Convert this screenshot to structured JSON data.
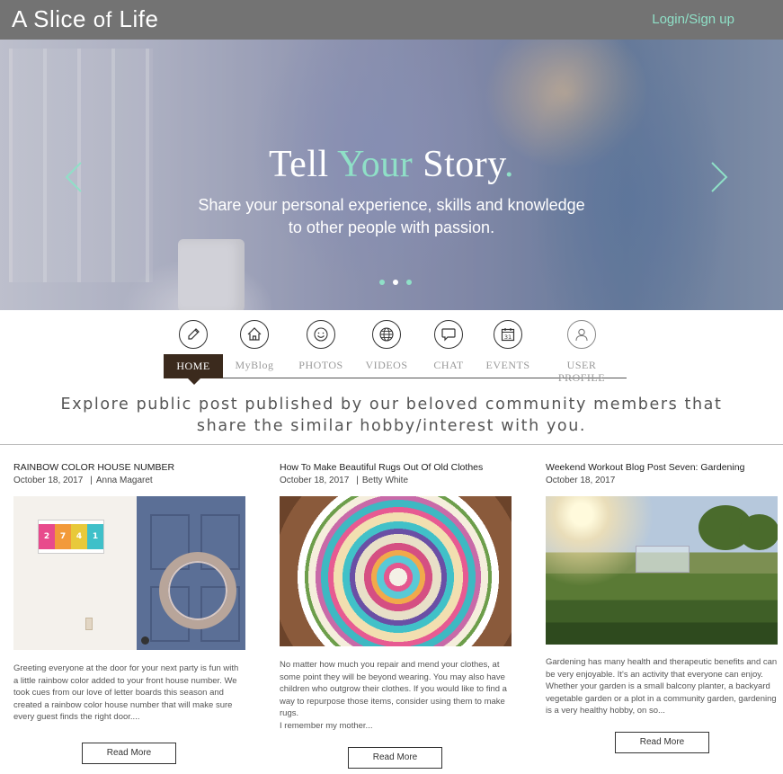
{
  "header": {
    "logo_part1": "A Slice",
    "logo_part2": "of",
    "logo_part3": "Life",
    "login_label": "Login/Sign up"
  },
  "hero": {
    "title_part1": "Tell",
    "title_accent": "Your",
    "title_part2": "Story",
    "title_dot": ".",
    "subtitle_line1": "Share your personal experience, skills and knowledge",
    "subtitle_line2": "to other people with passion.",
    "slide_count": 3,
    "active_slide": 2
  },
  "nav": {
    "items": [
      {
        "label": "HOME",
        "icon": "pencil-icon"
      },
      {
        "label": "MyBlog",
        "icon": "home-icon"
      },
      {
        "label": "PHOTOS",
        "icon": "smiley-icon"
      },
      {
        "label": "VIDEOS",
        "icon": "globe-icon"
      },
      {
        "label": "CHAT",
        "icon": "chat-bubble-icon"
      },
      {
        "label": "EVENTS",
        "icon": "calendar-icon"
      },
      {
        "label": "USER PROFILE",
        "icon": "user-icon"
      }
    ],
    "calendar_day": "31"
  },
  "intro": {
    "line1": "Explore public post published by our beloved community members that",
    "line2": "share the similar hobby/interest with you."
  },
  "posts": [
    {
      "title": "RAINBOW COLOR HOUSE NUMBER",
      "date": "October 18, 2017",
      "author": "Anna Magaret",
      "sign_digits": [
        "2",
        "7",
        "4",
        "1"
      ],
      "excerpt": "Greeting everyone at the door for your next party is fun with a little rainbow color added to your front house number. We took cues from our love of letter boards this season and created a rainbow color house number that will make sure every guest finds the right door....",
      "button": "Read More"
    },
    {
      "title": "How To Make Beautiful Rugs Out Of Old Clothes",
      "date": "October 18, 2017",
      "author": "Betty White",
      "excerpt": "No matter how much you repair and mend your clothes, at some point they will be beyond wearing.  You may also have children who outgrow their clothes.  If you would like to find a way to repurpose those items, consider using them to make rugs.",
      "excerpt2": "I remember my mother...",
      "button": "Read More"
    },
    {
      "title": "Weekend Workout Blog Post Seven: Gardening",
      "date": "October 18, 2017",
      "author": "",
      "excerpt": "Gardening has many health and therapeutic benefits and can be very enjoyable. It's an activity that everyone can enjoy.  Whether your garden is a small balcony planter, a backyard vegetable garden or a plot in a community garden, gardening is a very healthy hobby, on so...",
      "button": "Read More"
    }
  ],
  "colors": {
    "accent": "#8fe0c7",
    "header_bg": "#737373",
    "nav_active_bg": "#3b2a1d",
    "sign_colors": [
      "#e84a8c",
      "#f29a3a",
      "#e8c93a",
      "#3fc0c9"
    ]
  }
}
